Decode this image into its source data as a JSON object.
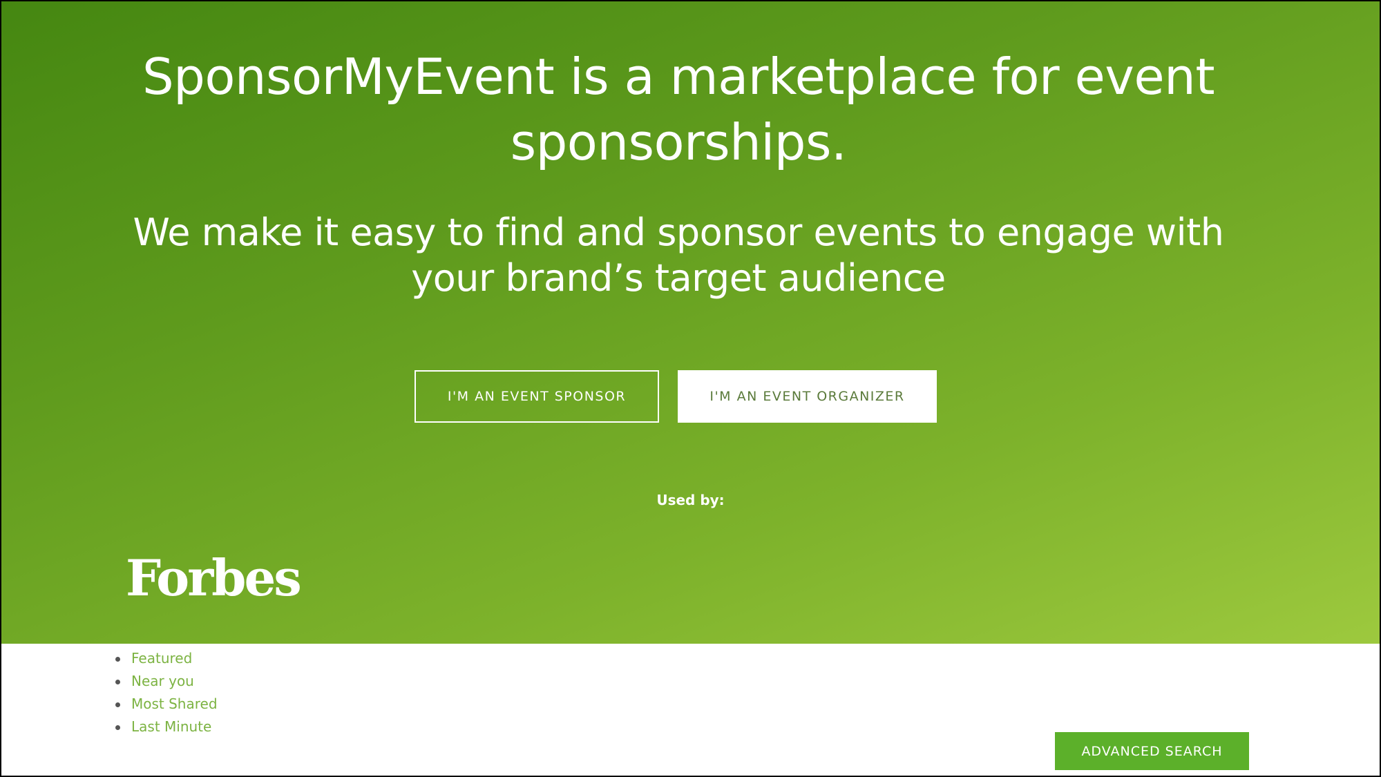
{
  "hero": {
    "headline": "SponsorMyEvent is a marketplace for event sponsorships.",
    "subheadline": "We make it easy to find and sponsor events to engage with your brand’s target audience",
    "sponsor_button": "I'M AN EVENT SPONSOR",
    "organizer_button": "I'M AN EVENT ORGANIZER",
    "used_by_label": "Used by:",
    "logo_text": "Forbes",
    "gradient_colors": [
      "#458711",
      "#9dc93e"
    ]
  },
  "event_tabs": [
    {
      "label": "Featured"
    },
    {
      "label": "Near you"
    },
    {
      "label": "Most Shared"
    },
    {
      "label": "Last Minute"
    }
  ],
  "advanced_search": {
    "label": "ADVANCED SEARCH",
    "color": "#5cb02a"
  },
  "colors": {
    "link": "#7cb342",
    "organizer_text": "#5a7a3a"
  }
}
